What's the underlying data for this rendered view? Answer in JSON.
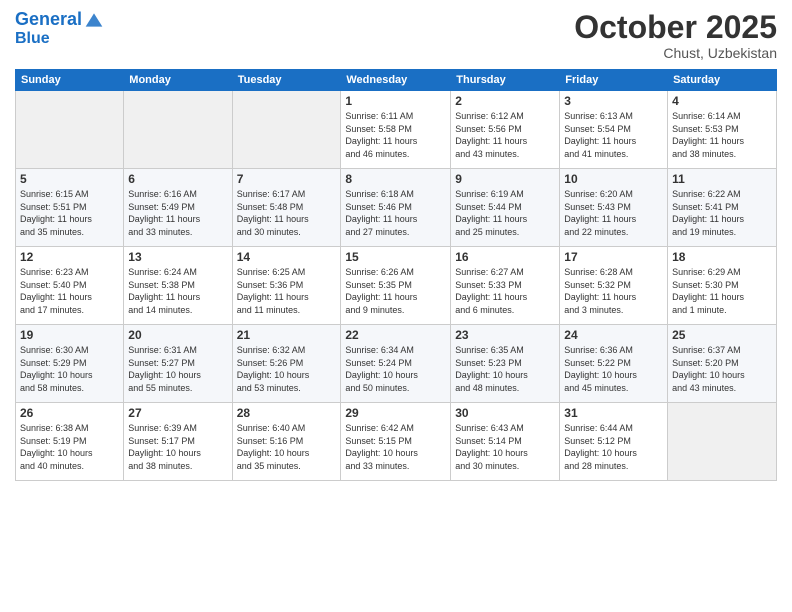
{
  "header": {
    "logo_line1": "General",
    "logo_line2": "Blue",
    "month": "October 2025",
    "location": "Chust, Uzbekistan"
  },
  "weekdays": [
    "Sunday",
    "Monday",
    "Tuesday",
    "Wednesday",
    "Thursday",
    "Friday",
    "Saturday"
  ],
  "weeks": [
    [
      {
        "day": "",
        "info": ""
      },
      {
        "day": "",
        "info": ""
      },
      {
        "day": "",
        "info": ""
      },
      {
        "day": "1",
        "info": "Sunrise: 6:11 AM\nSunset: 5:58 PM\nDaylight: 11 hours\nand 46 minutes."
      },
      {
        "day": "2",
        "info": "Sunrise: 6:12 AM\nSunset: 5:56 PM\nDaylight: 11 hours\nand 43 minutes."
      },
      {
        "day": "3",
        "info": "Sunrise: 6:13 AM\nSunset: 5:54 PM\nDaylight: 11 hours\nand 41 minutes."
      },
      {
        "day": "4",
        "info": "Sunrise: 6:14 AM\nSunset: 5:53 PM\nDaylight: 11 hours\nand 38 minutes."
      }
    ],
    [
      {
        "day": "5",
        "info": "Sunrise: 6:15 AM\nSunset: 5:51 PM\nDaylight: 11 hours\nand 35 minutes."
      },
      {
        "day": "6",
        "info": "Sunrise: 6:16 AM\nSunset: 5:49 PM\nDaylight: 11 hours\nand 33 minutes."
      },
      {
        "day": "7",
        "info": "Sunrise: 6:17 AM\nSunset: 5:48 PM\nDaylight: 11 hours\nand 30 minutes."
      },
      {
        "day": "8",
        "info": "Sunrise: 6:18 AM\nSunset: 5:46 PM\nDaylight: 11 hours\nand 27 minutes."
      },
      {
        "day": "9",
        "info": "Sunrise: 6:19 AM\nSunset: 5:44 PM\nDaylight: 11 hours\nand 25 minutes."
      },
      {
        "day": "10",
        "info": "Sunrise: 6:20 AM\nSunset: 5:43 PM\nDaylight: 11 hours\nand 22 minutes."
      },
      {
        "day": "11",
        "info": "Sunrise: 6:22 AM\nSunset: 5:41 PM\nDaylight: 11 hours\nand 19 minutes."
      }
    ],
    [
      {
        "day": "12",
        "info": "Sunrise: 6:23 AM\nSunset: 5:40 PM\nDaylight: 11 hours\nand 17 minutes."
      },
      {
        "day": "13",
        "info": "Sunrise: 6:24 AM\nSunset: 5:38 PM\nDaylight: 11 hours\nand 14 minutes."
      },
      {
        "day": "14",
        "info": "Sunrise: 6:25 AM\nSunset: 5:36 PM\nDaylight: 11 hours\nand 11 minutes."
      },
      {
        "day": "15",
        "info": "Sunrise: 6:26 AM\nSunset: 5:35 PM\nDaylight: 11 hours\nand 9 minutes."
      },
      {
        "day": "16",
        "info": "Sunrise: 6:27 AM\nSunset: 5:33 PM\nDaylight: 11 hours\nand 6 minutes."
      },
      {
        "day": "17",
        "info": "Sunrise: 6:28 AM\nSunset: 5:32 PM\nDaylight: 11 hours\nand 3 minutes."
      },
      {
        "day": "18",
        "info": "Sunrise: 6:29 AM\nSunset: 5:30 PM\nDaylight: 11 hours\nand 1 minute."
      }
    ],
    [
      {
        "day": "19",
        "info": "Sunrise: 6:30 AM\nSunset: 5:29 PM\nDaylight: 10 hours\nand 58 minutes."
      },
      {
        "day": "20",
        "info": "Sunrise: 6:31 AM\nSunset: 5:27 PM\nDaylight: 10 hours\nand 55 minutes."
      },
      {
        "day": "21",
        "info": "Sunrise: 6:32 AM\nSunset: 5:26 PM\nDaylight: 10 hours\nand 53 minutes."
      },
      {
        "day": "22",
        "info": "Sunrise: 6:34 AM\nSunset: 5:24 PM\nDaylight: 10 hours\nand 50 minutes."
      },
      {
        "day": "23",
        "info": "Sunrise: 6:35 AM\nSunset: 5:23 PM\nDaylight: 10 hours\nand 48 minutes."
      },
      {
        "day": "24",
        "info": "Sunrise: 6:36 AM\nSunset: 5:22 PM\nDaylight: 10 hours\nand 45 minutes."
      },
      {
        "day": "25",
        "info": "Sunrise: 6:37 AM\nSunset: 5:20 PM\nDaylight: 10 hours\nand 43 minutes."
      }
    ],
    [
      {
        "day": "26",
        "info": "Sunrise: 6:38 AM\nSunset: 5:19 PM\nDaylight: 10 hours\nand 40 minutes."
      },
      {
        "day": "27",
        "info": "Sunrise: 6:39 AM\nSunset: 5:17 PM\nDaylight: 10 hours\nand 38 minutes."
      },
      {
        "day": "28",
        "info": "Sunrise: 6:40 AM\nSunset: 5:16 PM\nDaylight: 10 hours\nand 35 minutes."
      },
      {
        "day": "29",
        "info": "Sunrise: 6:42 AM\nSunset: 5:15 PM\nDaylight: 10 hours\nand 33 minutes."
      },
      {
        "day": "30",
        "info": "Sunrise: 6:43 AM\nSunset: 5:14 PM\nDaylight: 10 hours\nand 30 minutes."
      },
      {
        "day": "31",
        "info": "Sunrise: 6:44 AM\nSunset: 5:12 PM\nDaylight: 10 hours\nand 28 minutes."
      },
      {
        "day": "",
        "info": ""
      }
    ]
  ]
}
